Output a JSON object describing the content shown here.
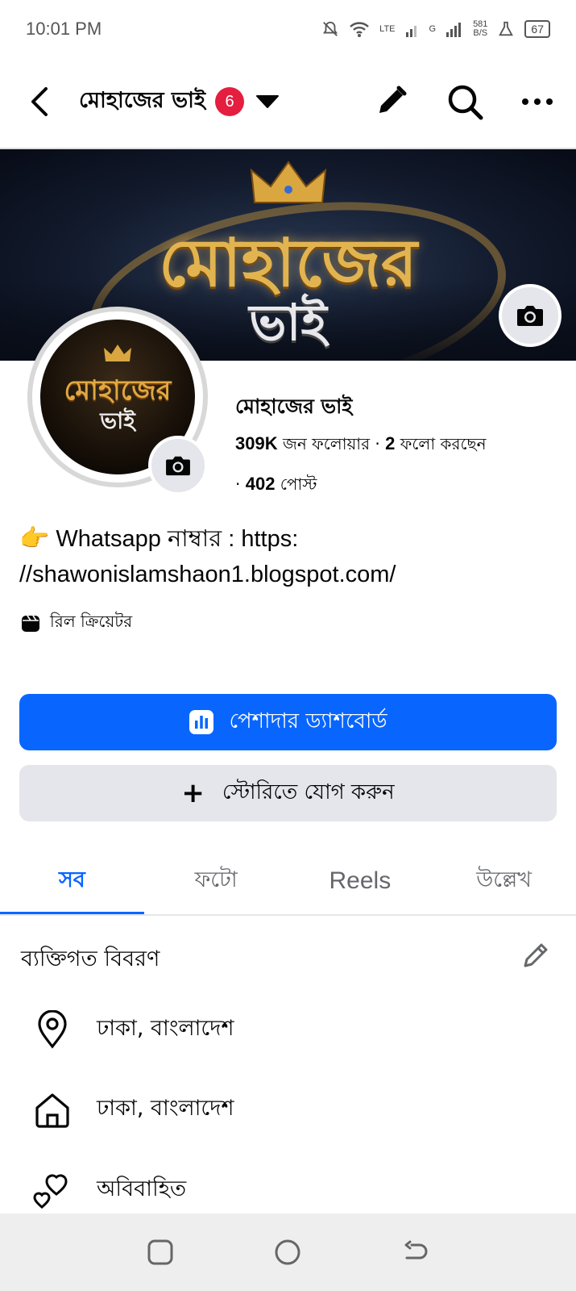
{
  "status_bar": {
    "time": "10:01 PM",
    "network_1": "LTE",
    "network_2": "G",
    "speed_value": "581",
    "speed_unit": "B/S",
    "battery": "67"
  },
  "header": {
    "title": "মোহাজের ভাই",
    "notification_count": "6"
  },
  "cover": {
    "title": "মোহাজের",
    "subtitle": "ভাই"
  },
  "avatar": {
    "title": "মোহাজের",
    "subtitle": "ভাই"
  },
  "profile": {
    "name": "মোহাজের ভাই",
    "followers_count": "309K",
    "followers_label": " জন ফলোয়ার · ",
    "following_count": "2",
    "following_label": " ফলো করছেন",
    "posts_prefix": "· ",
    "posts_count": "402",
    "posts_label": " পোস্ট",
    "bio_emoji": "👉",
    "bio_line1": "Whatsapp নাম্বার : https:",
    "bio_line2": "//shawonislamshaon1.blogspot.com/",
    "creator_label": "রিল ক্রিয়েটর"
  },
  "buttons": {
    "dashboard": "পেশাদার ড্যাশবোর্ড",
    "add_story": "স্টোরিতে যোগ করুন"
  },
  "tabs": [
    {
      "label": "সব",
      "active": true
    },
    {
      "label": "ফটো",
      "active": false
    },
    {
      "label": "Reels",
      "active": false
    },
    {
      "label": "উল্লেখ",
      "active": false
    }
  ],
  "details": {
    "section_title": "ব্যক্তিগত বিবরণ",
    "items": [
      {
        "icon": "location-pin-icon",
        "text": "ঢাকা, বাংলাদেশ"
      },
      {
        "icon": "home-icon",
        "text": "ঢাকা, বাংলাদেশ"
      },
      {
        "icon": "hearts-icon",
        "text": "অবিবাহিত"
      }
    ]
  },
  "colors": {
    "accent": "#0866ff",
    "badge": "#e41e3f",
    "secondary_button": "#e4e6eb"
  }
}
